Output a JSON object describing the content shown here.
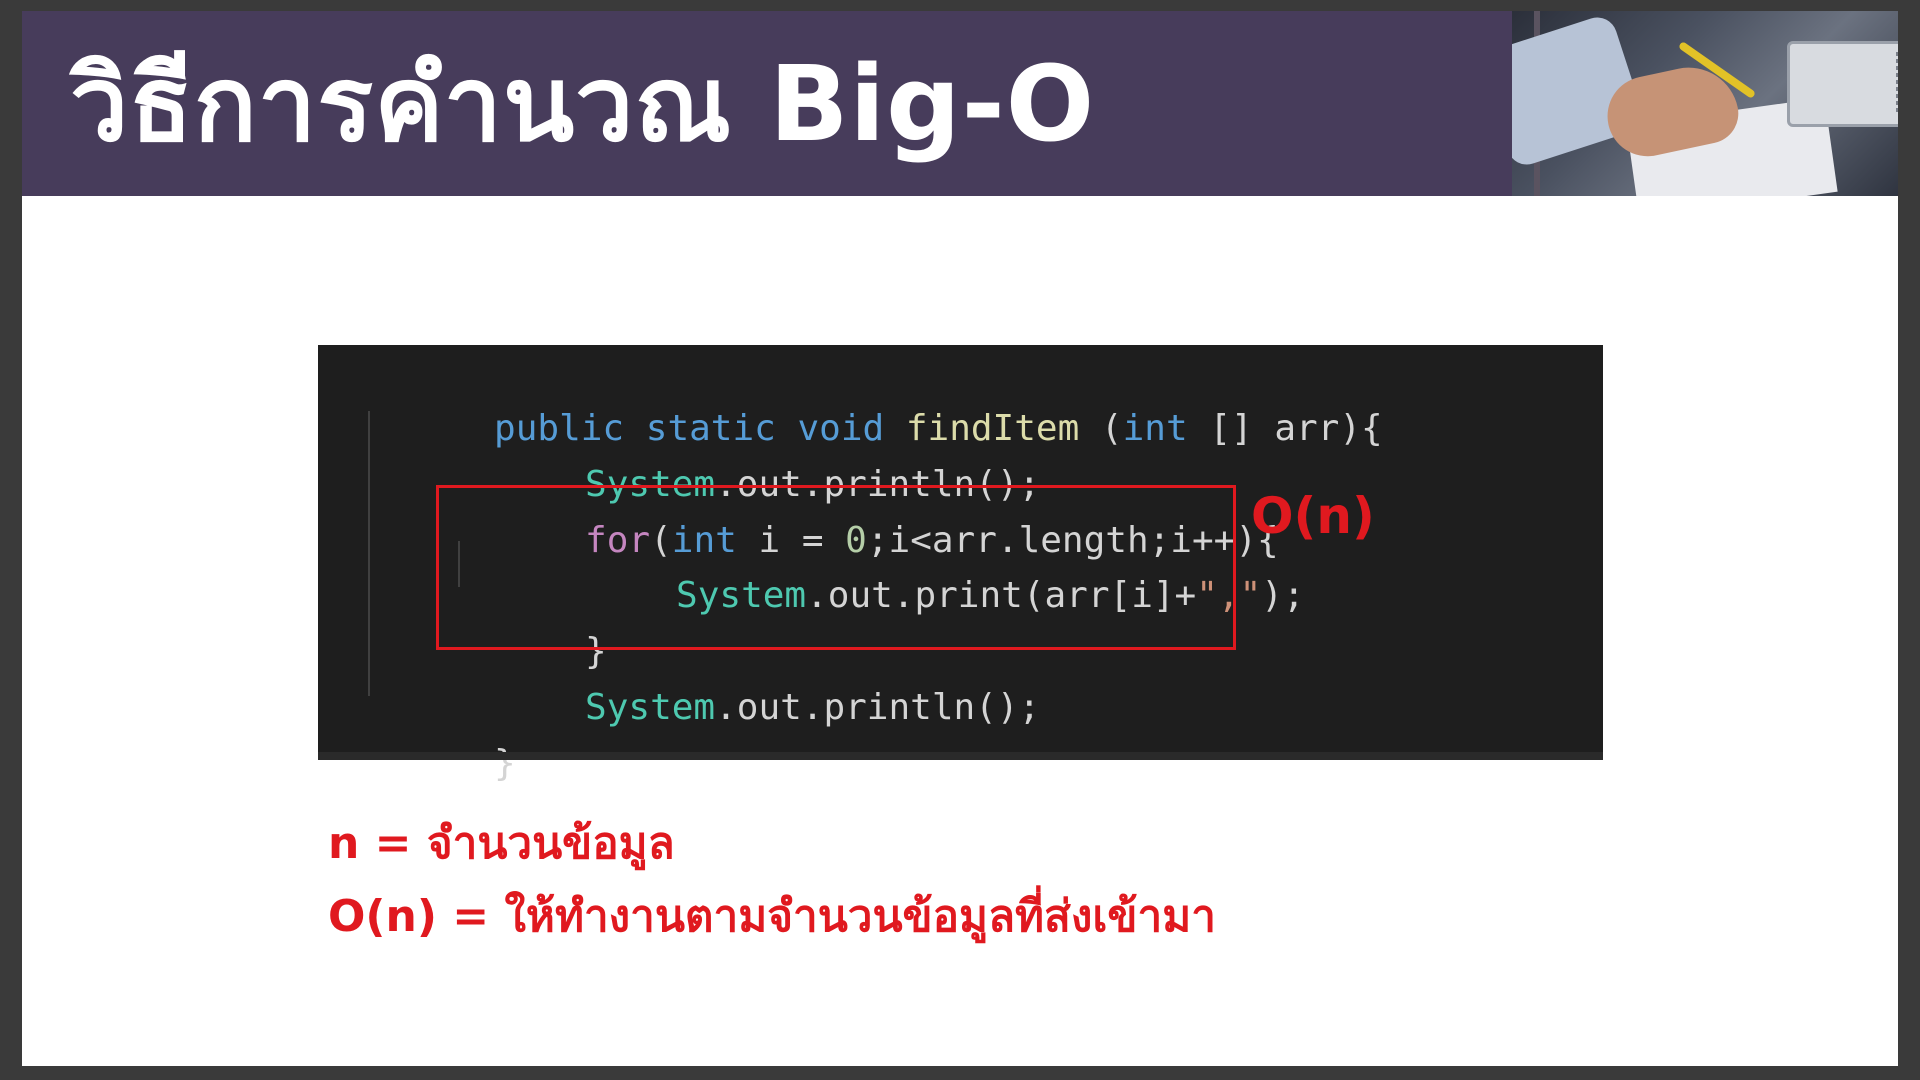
{
  "slide": {
    "title": "วิธีการคำนวณ Big-O",
    "header_image": "person-writing-at-desk-photo"
  },
  "code": {
    "line1": {
      "kw": "public static void ",
      "fn": "findItem",
      "rest1": " (",
      "type": "int",
      "rest2": " [] arr){"
    },
    "line2": {
      "obj": "System",
      "rest": ".out.println();"
    },
    "line3": {
      "ctrl": "for",
      "p1": "(",
      "type": "int",
      "p2": " i = ",
      "num": "0",
      "p3": ";i<arr.length;i++){"
    },
    "line4": {
      "obj": "System",
      "p1": ".out.print(arr[i]+",
      "str": "\",\"",
      "p2": ");"
    },
    "line5": {
      "text": "}"
    },
    "line6": {
      "obj": "System",
      "rest": ".out.println();"
    },
    "line7": {
      "text": "}"
    }
  },
  "annotation": {
    "complexity_label": "O(n)"
  },
  "notes": [
    "n = จำนวนข้อมูล",
    "O(n) = ให้ทำงานตามจำนวนข้อมูลที่ส่งเข้ามา"
  ],
  "colors": {
    "header_bg": "#473c5b",
    "accent_red": "#e0191f",
    "code_bg": "#1e1e1e"
  }
}
